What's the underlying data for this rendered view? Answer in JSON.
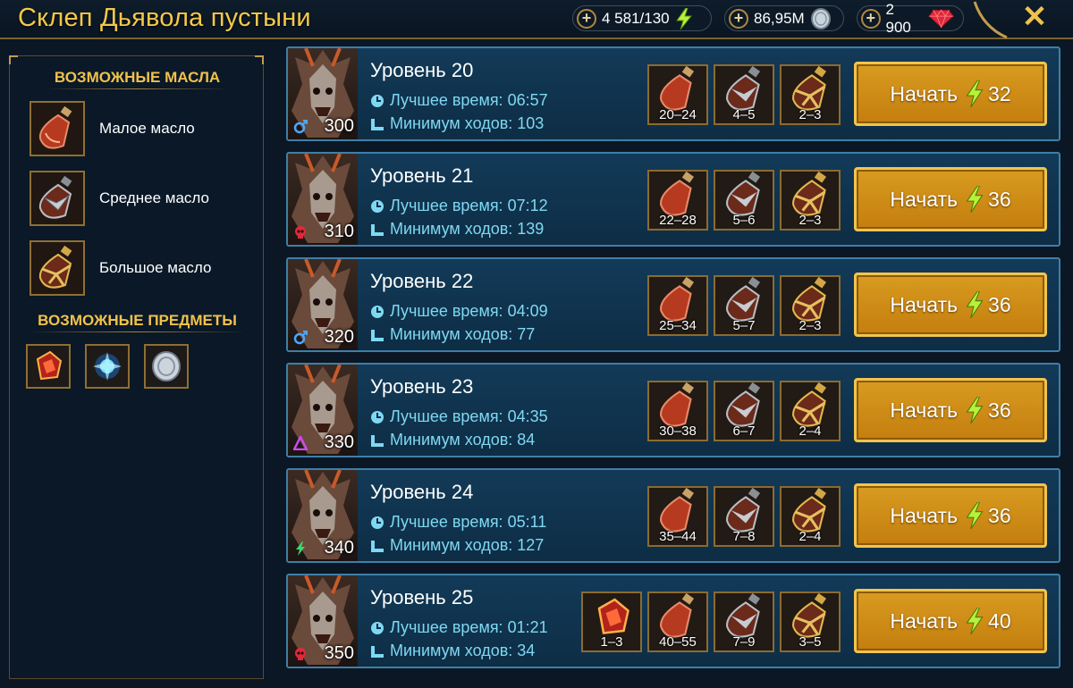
{
  "header": {
    "title": "Склеп Дьявола пустыни",
    "energy": "4 581/130",
    "silver": "86,95M",
    "gems": "2 900",
    "close_icon": "close-icon"
  },
  "left_panel": {
    "oils_title": "ВОЗМОЖНЫЕ МАСЛА",
    "oils": [
      {
        "name": "Малое масло",
        "icon": "small-oil-icon"
      },
      {
        "name": "Среднее масло",
        "icon": "medium-oil-icon"
      },
      {
        "name": "Большое масло",
        "icon": "large-oil-icon"
      }
    ],
    "items_title": "ВОЗМОЖНЫЕ ПРЕДМЕТЫ",
    "items": [
      "red-shard-icon",
      "blue-artifact-icon",
      "silver-coin-icon"
    ]
  },
  "levels": [
    {
      "name": "Уровень 20",
      "best_time": "Лучшее время: 06:57",
      "min_turns": "Минимум ходов: 103",
      "power": "300",
      "affinity": "magic",
      "rewards": [
        "20–24",
        "4–5",
        "2–3"
      ],
      "start_label": "Начать",
      "cost": "32"
    },
    {
      "name": "Уровень 21",
      "best_time": "Лучшее время: 07:12",
      "min_turns": "Минимум ходов: 139",
      "power": "310",
      "affinity": "force",
      "rewards": [
        "22–28",
        "5–6",
        "2–3"
      ],
      "start_label": "Начать",
      "cost": "36"
    },
    {
      "name": "Уровень 22",
      "best_time": "Лучшее время: 04:09",
      "min_turns": "Минимум ходов: 77",
      "power": "320",
      "affinity": "magic",
      "rewards": [
        "25–34",
        "5–7",
        "2–3"
      ],
      "start_label": "Начать",
      "cost": "36"
    },
    {
      "name": "Уровень 23",
      "best_time": "Лучшее время: 04:35",
      "min_turns": "Минимум ходов: 84",
      "power": "330",
      "affinity": "void",
      "rewards": [
        "30–38",
        "6–7",
        "2–4"
      ],
      "start_label": "Начать",
      "cost": "36"
    },
    {
      "name": "Уровень 24",
      "best_time": "Лучшее время: 05:11",
      "min_turns": "Минимум ходов: 127",
      "power": "340",
      "affinity": "spirit",
      "rewards": [
        "35–44",
        "7–8",
        "2–4"
      ],
      "start_label": "Начать",
      "cost": "36"
    },
    {
      "name": "Уровень 25",
      "best_time": "Лучшее время: 01:21",
      "min_turns": "Минимум ходов: 34",
      "power": "350",
      "affinity": "force",
      "extra_reward": "1–3",
      "rewards": [
        "40–55",
        "7–9",
        "3–5"
      ],
      "start_label": "Начать",
      "cost": "40"
    }
  ],
  "colors": {
    "gold": "#f0c24a",
    "button": "#d89b20",
    "row_bg": "#123a58",
    "stat_text": "#7fd8f2"
  }
}
